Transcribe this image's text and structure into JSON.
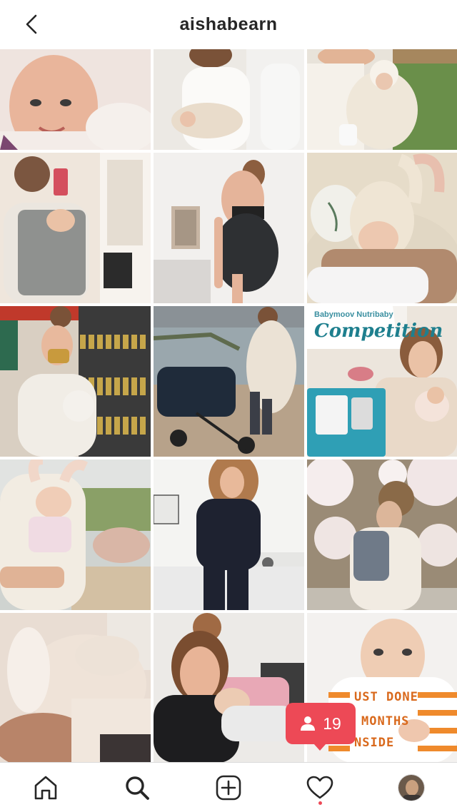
{
  "header": {
    "title": "aishabearn",
    "back_icon": "chevron-left-icon"
  },
  "posts": [
    {
      "id": "post-1"
    },
    {
      "id": "post-2"
    },
    {
      "id": "post-3"
    },
    {
      "id": "post-4"
    },
    {
      "id": "post-5"
    },
    {
      "id": "post-6"
    },
    {
      "id": "post-7"
    },
    {
      "id": "post-8"
    },
    {
      "id": "post-9"
    },
    {
      "id": "post-10"
    },
    {
      "id": "post-11"
    },
    {
      "id": "post-12"
    },
    {
      "id": "post-13"
    },
    {
      "id": "post-14"
    },
    {
      "id": "post-15"
    }
  ],
  "promo": {
    "brand": "Babymoov Nutribaby",
    "title": "Competition"
  },
  "shirt": {
    "line1": "UST DONE",
    "line2": "MONTHS",
    "line3": "NSIDE"
  },
  "notification": {
    "icon": "person-icon",
    "count": "19"
  },
  "nav": {
    "items": [
      "home-icon",
      "search-icon",
      "add-icon",
      "heart-icon",
      "profile-avatar"
    ]
  },
  "colors": {
    "accent": "#ed4956",
    "text": "#262626",
    "divider": "#dbdbdb"
  }
}
